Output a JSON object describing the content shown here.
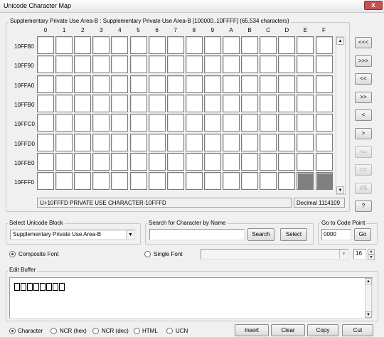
{
  "window": {
    "title": "Unicode Character Map",
    "close_label": "x"
  },
  "grid": {
    "legend": "Supplementary Private Use Area-B : Supplementary Private Use Area-B [100000..10FFFF] (65,534 characters)",
    "columns": [
      "0",
      "1",
      "2",
      "3",
      "4",
      "5",
      "6",
      "7",
      "8",
      "9",
      "A",
      "B",
      "C",
      "D",
      "E",
      "F"
    ],
    "rows": [
      "10FF80",
      "10FF90",
      "10FFA0",
      "10FFB0",
      "10FFC0",
      "10FFD0",
      "10FFE0",
      "10FFF0"
    ],
    "status_name": "U+10FFFD PRIVATE USE CHARACTER-10FFFD",
    "status_decimal": "Decimal 1114109"
  },
  "nav_buttons": [
    "<<<",
    ">>>",
    "<<",
    ">>",
    "<",
    ">",
    "<=",
    "=>",
    "VS",
    "?"
  ],
  "unicode_block": {
    "legend": "Select Unicode Block",
    "selected": "Supplementary Private Use Area-B"
  },
  "search": {
    "legend": "Search for Character by Name",
    "value": "",
    "search_label": "Search",
    "select_label": "Select"
  },
  "goto": {
    "legend": "Go to Code Point",
    "value": "0000",
    "go_label": "Go"
  },
  "font": {
    "composite_label": "Composite Font",
    "single_label": "Single Font",
    "size": "16"
  },
  "edit_buffer": {
    "legend": "Edit Buffer",
    "glyph_count": 8
  },
  "format_options": [
    "Character",
    "NCR (hex)",
    "NCR (dec)",
    "HTML",
    "UCN"
  ],
  "actions": {
    "insert": "Insert",
    "clear": "Clear",
    "copy": "Copy",
    "cut": "Cut"
  }
}
